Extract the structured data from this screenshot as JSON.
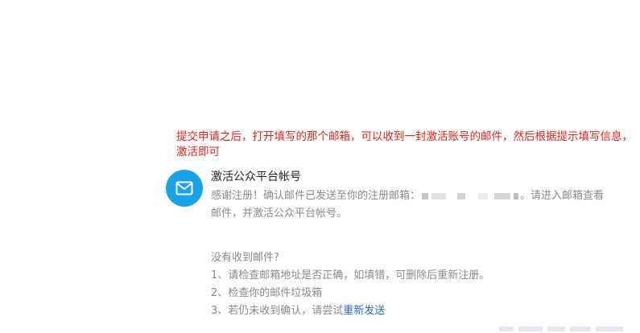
{
  "note": {
    "line1": "提交申请之后，打开填写的那个邮箱，可以收到一封激活账号的邮件，然后根据提示填写信息，",
    "line2": "激活即可"
  },
  "notification": {
    "icon": "mail-icon",
    "title": "激活公众平台帐号",
    "desc_prefix": "感谢注册！确认邮件已发送至你的注册邮箱：",
    "desc_suffix": "。请进入邮箱查看",
    "desc_line2": "邮件，并激活公众平台帐号。"
  },
  "help": {
    "heading": "没有收到邮件?",
    "item1": "1、请检查邮箱地址是否正确，如填错，可删除后重新注册。",
    "item2": "2、检查你的邮件垃圾箱",
    "item3_prefix": "3、若仍未收到确认，请尝试",
    "resend_link": "重新发送"
  },
  "colors": {
    "note_red": "#e2231a",
    "icon_blue": "#1aa2e8",
    "link_blue": "#2a6ac0"
  }
}
